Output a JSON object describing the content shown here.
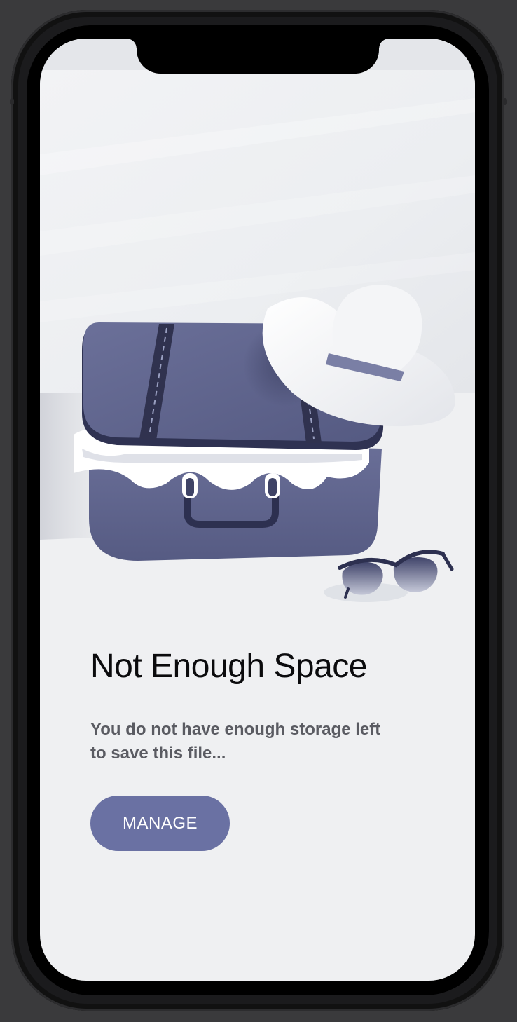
{
  "screen": {
    "title": "Not Enough Space",
    "message": "You do not have enough storage left to save this file...",
    "manage_button_label": "MANAGE"
  },
  "illustration": {
    "items": [
      "suitcase",
      "sun-hat",
      "sunglasses"
    ]
  },
  "colors": {
    "background": "#eff0f2",
    "accent": "#6a71a3",
    "title": "#0b0b0d",
    "message": "#5a5b62",
    "suitcase": "#5c618a"
  }
}
